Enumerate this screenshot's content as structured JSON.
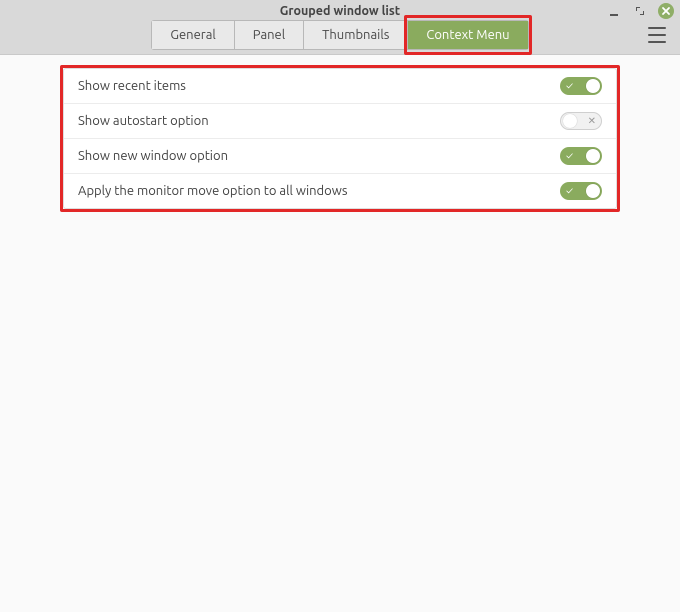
{
  "window": {
    "title": "Grouped window list"
  },
  "tabs": {
    "general": "General",
    "panel": "Panel",
    "thumbnails": "Thumbnails",
    "context_menu": "Context Menu"
  },
  "settings": {
    "items": [
      {
        "label": "Show recent items",
        "value": true
      },
      {
        "label": "Show autostart option",
        "value": false
      },
      {
        "label": "Show new window option",
        "value": true
      },
      {
        "label": "Apply the monitor move option to all windows",
        "value": true
      }
    ]
  },
  "marks": {
    "on": "✓",
    "off": "✕"
  }
}
